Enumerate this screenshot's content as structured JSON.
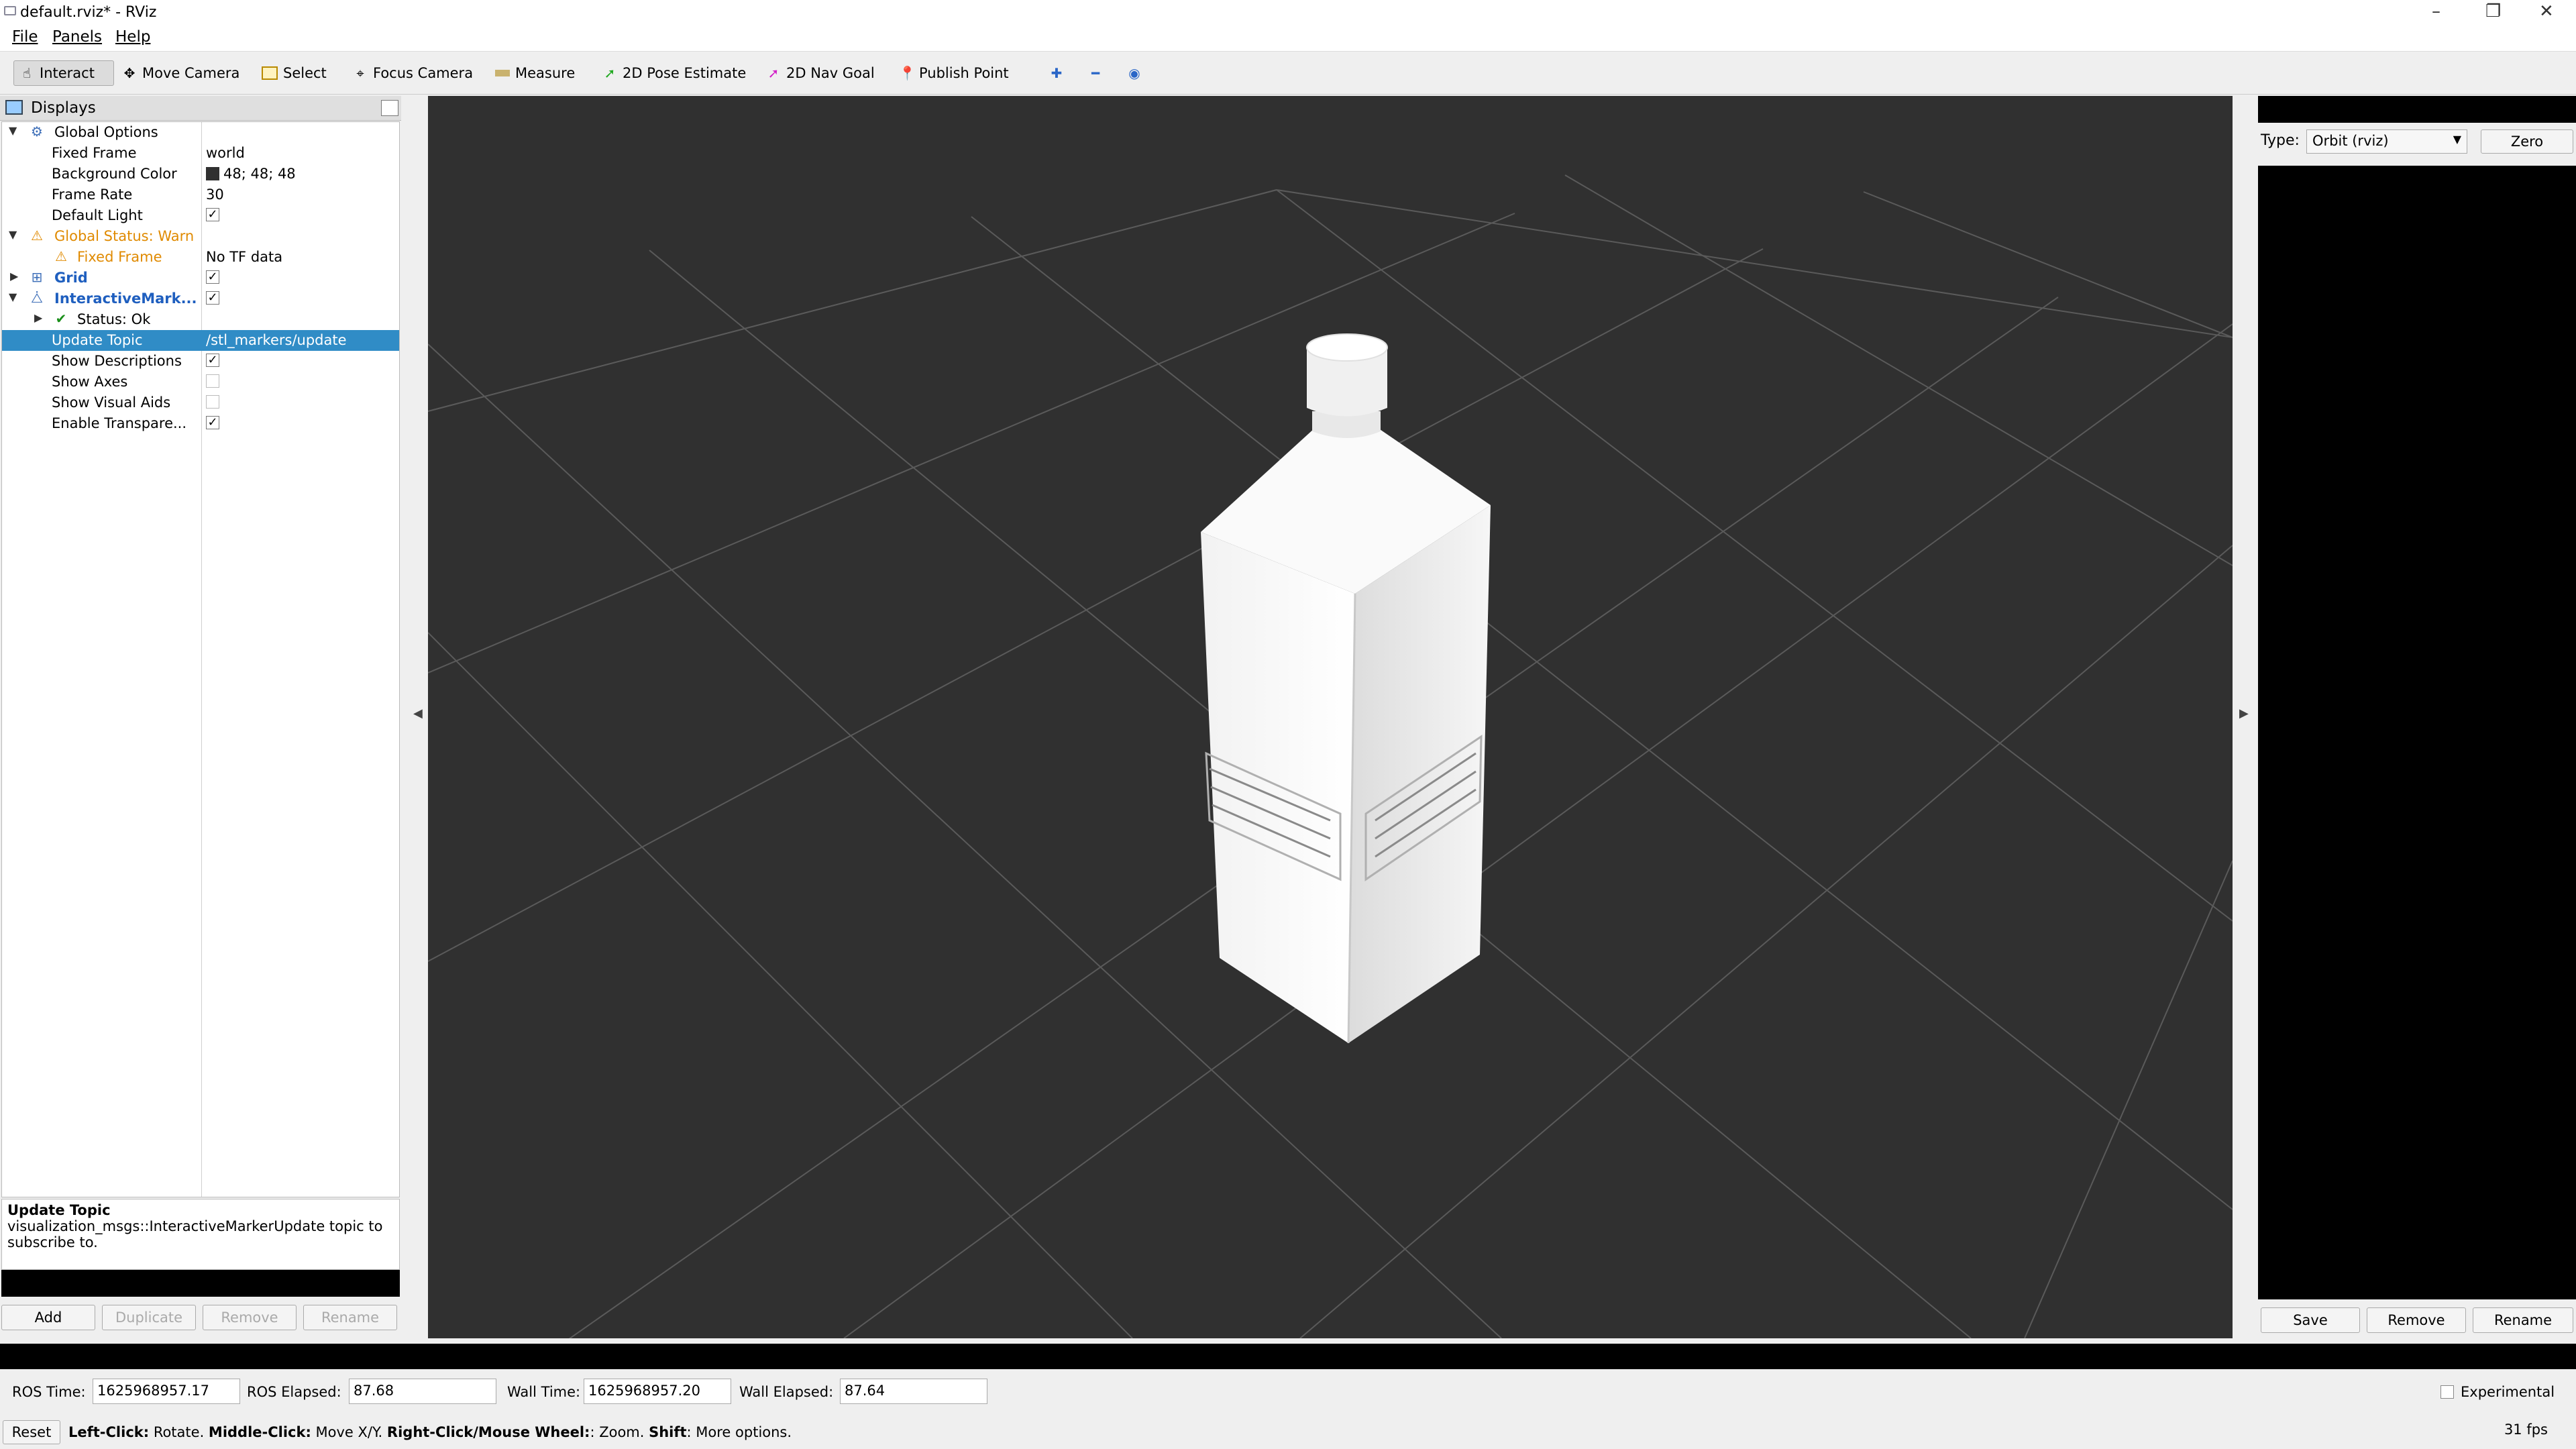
{
  "window": {
    "title": "default.rviz* - RViz"
  },
  "menu": {
    "file": "File",
    "panels": "Panels",
    "help": "Help"
  },
  "toolbar": {
    "interact": "Interact",
    "move_camera": "Move Camera",
    "select": "Select",
    "focus_camera": "Focus Camera",
    "measure": "Measure",
    "pose_estimate": "2D Pose Estimate",
    "nav_goal": "2D Nav Goal",
    "publish_point": "Publish Point"
  },
  "displays": {
    "title": "Displays",
    "rows": {
      "global_options": {
        "label": "Global Options"
      },
      "fixed_frame": {
        "label": "Fixed Frame",
        "value": "world"
      },
      "background_color": {
        "label": "Background Color",
        "value": "48; 48; 48",
        "color": "#303030"
      },
      "frame_rate": {
        "label": "Frame Rate",
        "value": "30"
      },
      "default_light": {
        "label": "Default Light",
        "checked": true
      },
      "global_status": {
        "label": "Global Status: Warn"
      },
      "status_fixed_frame": {
        "label": "Fixed Frame",
        "value": "No TF data"
      },
      "grid": {
        "label": "Grid",
        "checked": true
      },
      "interactive_markers": {
        "label": "InteractiveMark...",
        "checked": true
      },
      "status_ok": {
        "label": "Status: Ok"
      },
      "update_topic": {
        "label": "Update Topic",
        "value": "/stl_markers/update"
      },
      "show_descriptions": {
        "label": "Show Descriptions",
        "checked": true
      },
      "show_axes": {
        "label": "Show Axes",
        "checked": false
      },
      "show_visual_aids": {
        "label": "Show Visual Aids",
        "checked": false
      },
      "enable_transparency": {
        "label": "Enable Transpare...",
        "checked": true
      }
    },
    "help": {
      "title": "Update Topic",
      "text": "visualization_msgs::InteractiveMarkerUpdate topic to subscribe to."
    },
    "buttons": {
      "add": "Add",
      "duplicate": "Duplicate",
      "remove": "Remove",
      "rename": "Rename"
    }
  },
  "views": {
    "type_label": "Type:",
    "type_value": "Orbit (rviz)",
    "zero": "Zero",
    "save": "Save",
    "remove": "Remove",
    "rename": "Rename"
  },
  "time": {
    "ros_time_label": "ROS Time:",
    "ros_time": "1625968957.17",
    "ros_elapsed_label": "ROS Elapsed:",
    "ros_elapsed": "87.68",
    "wall_time_label": "Wall Time:",
    "wall_time": "1625968957.20",
    "wall_elapsed_label": "Wall Elapsed:",
    "wall_elapsed": "87.64",
    "experimental": "Experimental"
  },
  "status": {
    "reset": "Reset",
    "h_left": "Left-Click:",
    "t_left": " Rotate. ",
    "h_middle": "Middle-Click:",
    "t_middle": " Move X/Y. ",
    "h_right": "Right-Click/Mouse Wheel:",
    "t_right": ": Zoom. ",
    "h_shift": "Shift",
    "t_shift": ": More options.",
    "fps": "31 fps"
  },
  "colors": {
    "viewport_bg": "#303030",
    "selection": "#308cc6",
    "warn": "#e08a00",
    "link_blue": "#1f5fbf"
  }
}
